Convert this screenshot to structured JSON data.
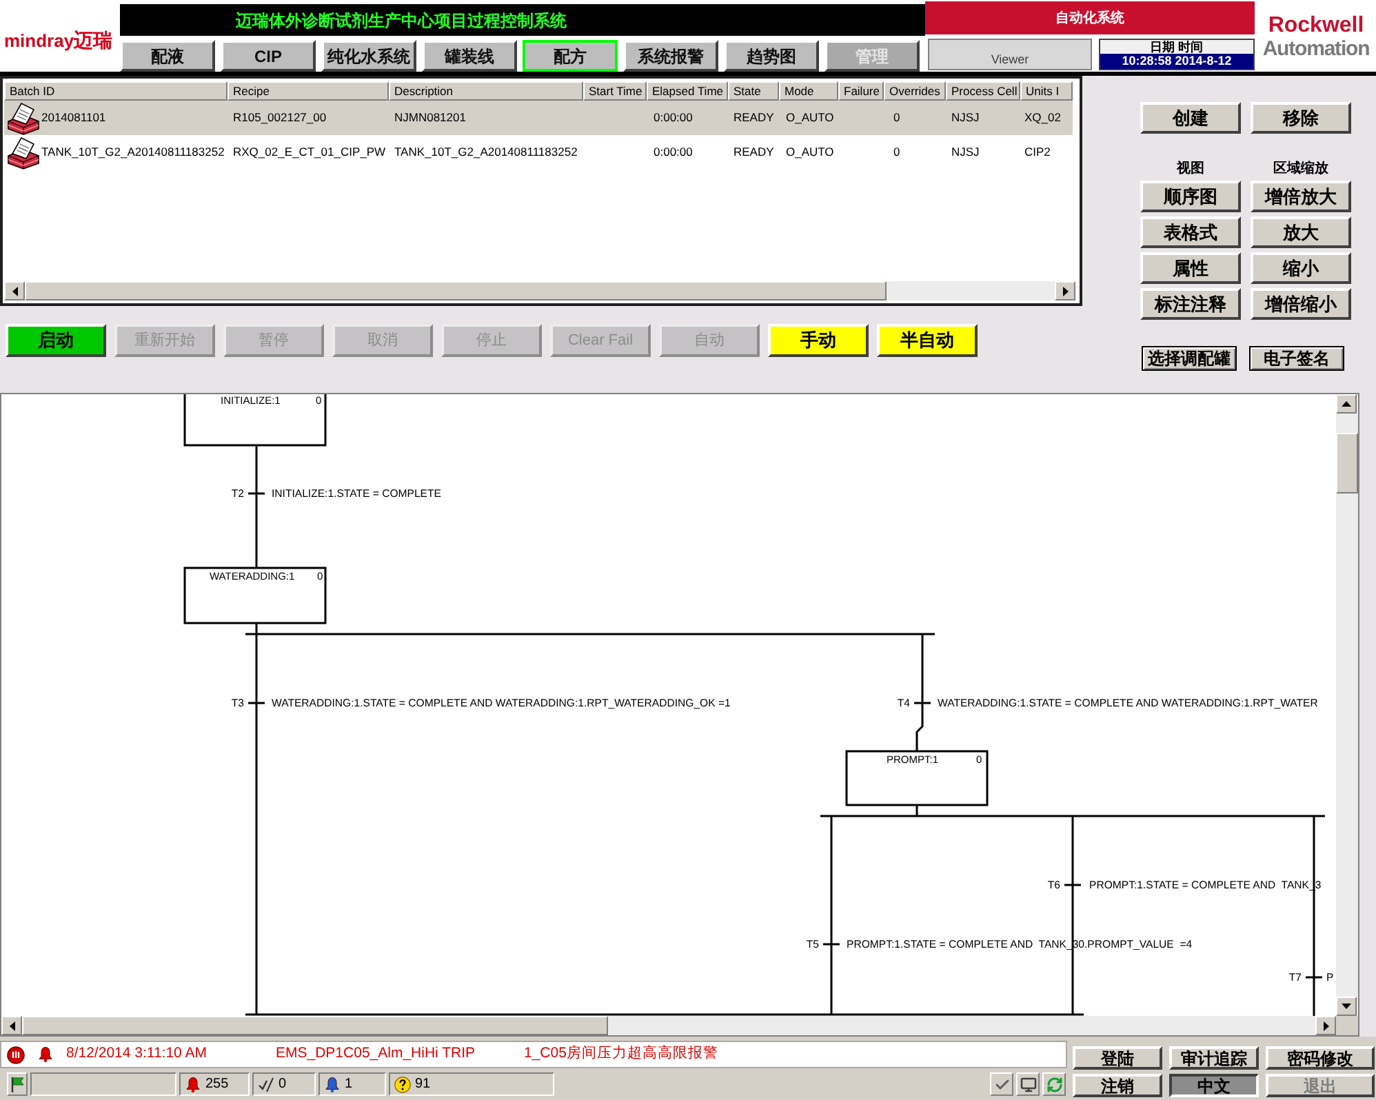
{
  "header": {
    "logo": {
      "brand": "mindray",
      "local": "迈瑞"
    },
    "title": "迈瑞体外诊断试剂生产中心项目过程控制系统",
    "nav": [
      {
        "label": "配液",
        "selected": false,
        "disabled": false
      },
      {
        "label": "CIP",
        "selected": false,
        "disabled": false
      },
      {
        "label": "纯化水系统",
        "selected": false,
        "disabled": false
      },
      {
        "label": "罐装线",
        "selected": false,
        "disabled": false
      },
      {
        "label": "配方",
        "selected": true,
        "disabled": false
      },
      {
        "label": "系统报警",
        "selected": false,
        "disabled": false
      },
      {
        "label": "趋势图",
        "selected": false,
        "disabled": false
      },
      {
        "label": "管理",
        "selected": false,
        "disabled": true
      }
    ],
    "system": "自动化系统",
    "user_role": "Viewer",
    "datetime": {
      "label": "日期 时间",
      "value": "10:28:58 2014-8-12"
    },
    "vendor": {
      "line_1": "Rockwell",
      "line_2": "Automation"
    }
  },
  "batch_table": {
    "columns": [
      "Batch ID",
      "Recipe",
      "Description",
      "Start Time",
      "Elapsed Time",
      "State",
      "Mode",
      "Failure",
      "Overrides",
      "Process Cell",
      "Units I"
    ],
    "rows": [
      {
        "selected": true,
        "batch_id": "2014081101",
        "recipe": "R105_002127_00",
        "description": "NJMN081201",
        "elapsed_time": "0:00:00",
        "state": "READY",
        "mode": "O_AUTO",
        "overrides": "0",
        "process_cell": "NJSJ",
        "column_11": "XQ_02"
      },
      {
        "selected": false,
        "batch_id": "TANK_10T_G2_A20140811183252",
        "recipe": "RXQ_02_E_CT_01_CIP_PW",
        "description": "TANK_10T_G2_A20140811183252",
        "elapsed_time": "0:00:00",
        "state": "READY",
        "mode": "O_AUTO",
        "overrides": "0",
        "process_cell": "NJSJ",
        "column_11": "CIP2"
      }
    ]
  },
  "right_panel": {
    "actions": [
      "创建",
      "移除"
    ],
    "view": {
      "label": "视图",
      "buttons": [
        "顺序图",
        "表格式",
        "属性",
        "标注注释"
      ]
    },
    "zoom": {
      "label": "区域缩放",
      "buttons": [
        "增倍放大",
        "放大",
        "缩小",
        "增倍缩小"
      ]
    },
    "extra": [
      "选择调配罐",
      "电子签名"
    ]
  },
  "commands": [
    {
      "label": "启动",
      "kind": "start",
      "disabled": false
    },
    {
      "label": "重新开始",
      "kind": "action",
      "disabled": true
    },
    {
      "label": "暂停",
      "kind": "action",
      "disabled": true
    },
    {
      "label": "取消",
      "kind": "action",
      "disabled": true
    },
    {
      "label": "停止",
      "kind": "action",
      "disabled": true
    },
    {
      "label": "Clear Fail",
      "kind": "action",
      "disabled": true
    },
    {
      "label": "自动",
      "kind": "action",
      "disabled": true
    },
    {
      "label": "手动",
      "kind": "mode",
      "disabled": false
    },
    {
      "label": "半自动",
      "kind": "mode",
      "disabled": false
    }
  ],
  "sfc": {
    "steps": [
      {
        "name": "INITIALIZE:1",
        "count": "0"
      },
      {
        "name": "WATERADDING:1",
        "count": "0"
      },
      {
        "name": "PROMPT:1",
        "count": "0"
      }
    ],
    "transitions": [
      {
        "label": "T2",
        "condition": "INITIALIZE:1.STATE = COMPLETE"
      },
      {
        "label": "T3",
        "condition": "WATERADDING:1.STATE = COMPLETE AND WATERADDING:1.RPT_WATERADDING_OK =1"
      },
      {
        "label": "T4",
        "condition": "WATERADDING:1.STATE = COMPLETE AND WATERADDING:1.RPT_WATER"
      },
      {
        "label": "T6",
        "condition": "PROMPT:1.STATE = COMPLETE AND  TANK_3"
      },
      {
        "label": "T5",
        "condition": "PROMPT:1.STATE = COMPLETE AND  TANK_30.PROMPT_VALUE  =4"
      },
      {
        "label": "T7",
        "condition": "P"
      }
    ]
  },
  "alarm": {
    "time": "8/12/2014 3:11:10 AM",
    "tag": "EMS_DP1C05_Alm_HiHi TRIP",
    "message": "1_C05房间压力超高高限报警"
  },
  "counters": [
    {
      "kind": "alarm",
      "value": "255"
    },
    {
      "kind": "acknowledged",
      "value": "0"
    },
    {
      "kind": "info",
      "value": "1"
    },
    {
      "kind": "unknown",
      "value": "91"
    }
  ],
  "footer_buttons": [
    {
      "label": "登陆",
      "selected": false,
      "disabled": false
    },
    {
      "label": "审计追踪",
      "selected": false,
      "disabled": false
    },
    {
      "label": "密码修改",
      "selected": false,
      "disabled": false
    },
    {
      "label": "注销",
      "selected": false,
      "disabled": false
    },
    {
      "label": "中文",
      "selected": true,
      "disabled": false
    },
    {
      "label": "退出",
      "selected": false,
      "disabled": true
    }
  ]
}
